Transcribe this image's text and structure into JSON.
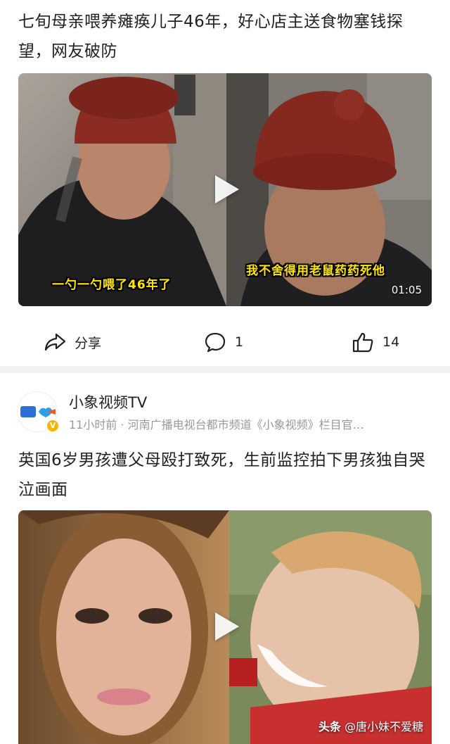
{
  "post1": {
    "title": "七旬母亲喂养瘫痪儿子46年，好心店主送食物塞钱探望，网友破防",
    "video": {
      "caption_left": "一勺一勺喂了46年了",
      "caption_right": "我不舍得用老鼠药药死他",
      "duration": "01:05"
    },
    "actions": {
      "share_label": "分享",
      "comment_count": "1",
      "like_count": "14"
    }
  },
  "post2": {
    "author": {
      "name": "小象视频TV",
      "meta": "11小时前 · 河南广播电视台都市频道《小象视频》栏目官…",
      "verified_mark": "V"
    },
    "title": "英国6岁男孩遭父母殴打致死，生前监控拍下男孩独自哭泣画面",
    "watermark_platform": "头条",
    "watermark_handle": "@唐小妹不爱糖"
  },
  "colors": {
    "caption_yellow": "#ffe600",
    "divider": "#f2f2f2",
    "meta_gray": "#999999",
    "verified": "#f4b400"
  }
}
